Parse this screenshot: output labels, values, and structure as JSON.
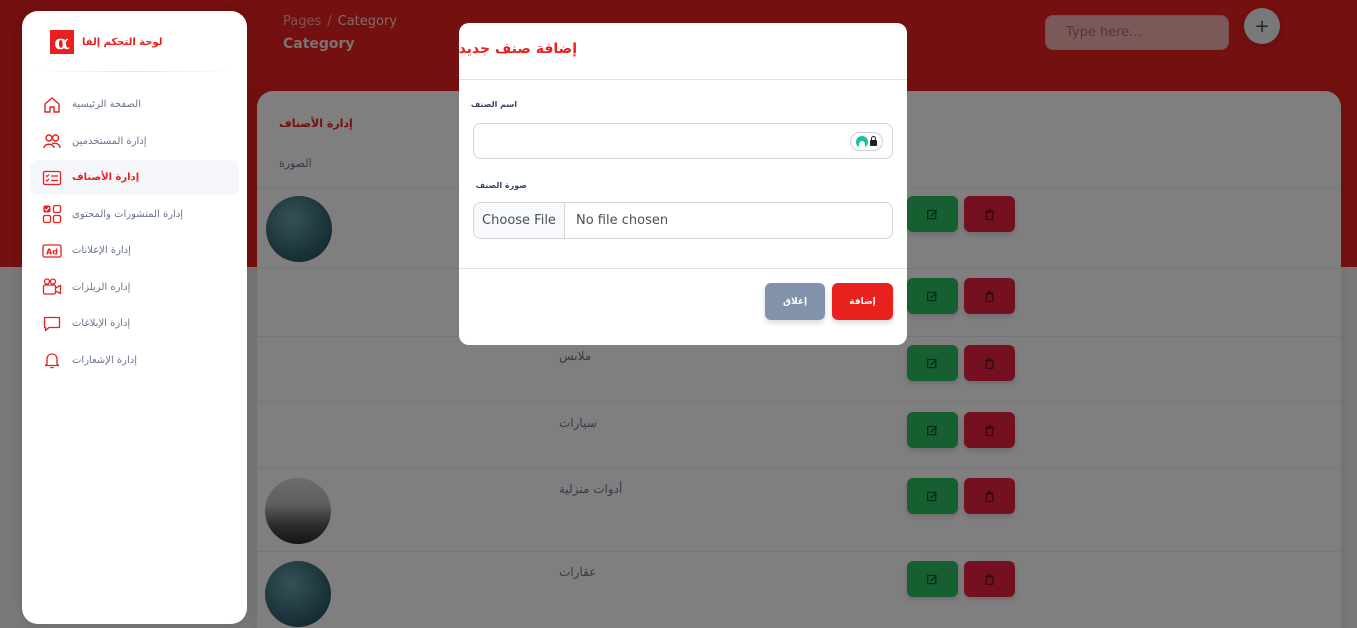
{
  "brand": {
    "logo_glyph": "α",
    "name": "لوحة التحكم إلفا"
  },
  "sidebar": {
    "items": [
      {
        "label": "الصفحة الرئيسية",
        "icon": "home-icon",
        "active": false
      },
      {
        "label": "إدارة المستخدمين",
        "icon": "users-icon",
        "active": false
      },
      {
        "label": "إدارة الأصناف",
        "icon": "checklist-icon",
        "active": true
      },
      {
        "label": "إدارة المنشورات والمحتوى",
        "icon": "content-grid-icon",
        "active": false
      },
      {
        "label": "إدارة الإعلانات",
        "icon": "ad-icon",
        "active": false
      },
      {
        "label": "إدارة الريلزات",
        "icon": "video-camera-icon",
        "active": false
      },
      {
        "label": "إدارة الإبلاغات",
        "icon": "chat-bubble-icon",
        "active": false
      },
      {
        "label": "إدارة الإشعارات",
        "icon": "bell-icon",
        "active": false
      }
    ]
  },
  "header": {
    "breadcrumb_root": "Pages",
    "breadcrumb_separator": "/",
    "breadcrumb_current": "Category",
    "title": "Category",
    "search_placeholder": "Type here...",
    "plus_label": "+"
  },
  "table": {
    "title": "إدارة الأصناف",
    "image_column": "الصورة",
    "rows": [
      {
        "name": "",
        "avatar": "building"
      },
      {
        "name": "",
        "avatar": ""
      },
      {
        "name": "ملابس",
        "avatar": ""
      },
      {
        "name": "سيارات",
        "avatar": ""
      },
      {
        "name": "أدوات منزلية",
        "avatar": "house"
      },
      {
        "name": "عقارات",
        "avatar": "building"
      }
    ]
  },
  "modal": {
    "title": "إضافة صنف جديد",
    "name_label": "اسم الصنف",
    "name_value": "",
    "image_label": "صورة الصنف",
    "file_button": "Choose File",
    "file_status": "No file chosen",
    "close_label": "إغلاق",
    "add_label": "إضافة"
  },
  "colors": {
    "brand_red": "#e8201e",
    "edit_green": "#2dbe60",
    "delete_red": "#e8203e",
    "close_gray": "#8392ab"
  }
}
